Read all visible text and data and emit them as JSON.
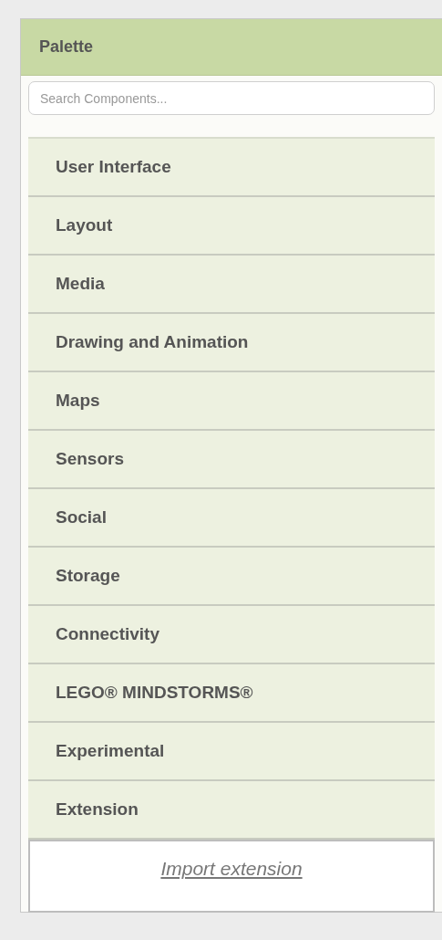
{
  "palette": {
    "title": "Palette",
    "search": {
      "placeholder": "Search Components..."
    },
    "categories": [
      {
        "label": "User Interface"
      },
      {
        "label": "Layout"
      },
      {
        "label": "Media"
      },
      {
        "label": "Drawing and Animation"
      },
      {
        "label": "Maps"
      },
      {
        "label": "Sensors"
      },
      {
        "label": "Social"
      },
      {
        "label": "Storage"
      },
      {
        "label": "Connectivity"
      },
      {
        "label": "LEGO® MINDSTORMS®"
      },
      {
        "label": "Experimental"
      },
      {
        "label": "Extension"
      }
    ],
    "import_link": "Import extension"
  }
}
